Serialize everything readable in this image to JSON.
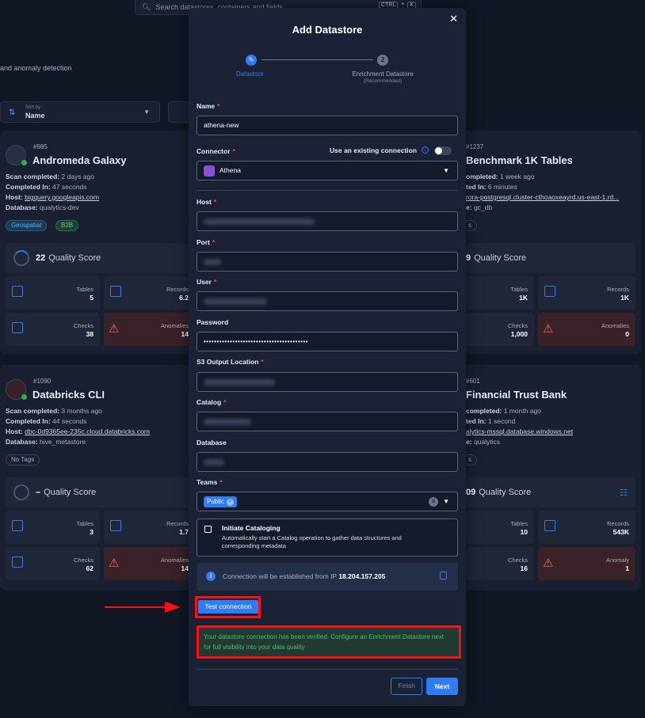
{
  "background": {
    "search_placeholder": "Search datastores, containers and fields",
    "kbd": [
      "CTRL",
      "+",
      "K"
    ],
    "subtitle_fragment": "and anomaly detection",
    "sort": {
      "label": "Sort by",
      "value": "Name"
    },
    "cards": [
      {
        "id": "#985",
        "name": "Andromeda Galaxy",
        "scan_label": "Scan completed:",
        "scan": "2 days ago",
        "completed_label": "Completed In:",
        "completed": "47 seconds",
        "host_label": "Host:",
        "host": "bigquery.googleapis.com",
        "db_label": "Database:",
        "db": "qualytics-dev",
        "tags": [
          "Geospatial",
          "B2B"
        ],
        "quality_score": "22",
        "quality_label": "Quality Score",
        "stats": [
          {
            "label": "Tables",
            "value": "5"
          },
          {
            "label": "Records",
            "value": "6.2"
          },
          {
            "label": "Checks",
            "value": "38"
          },
          {
            "label": "Anomalies",
            "value": "14"
          }
        ]
      },
      {
        "id": "#1237",
        "name": "Benchmark 1K Tables",
        "scan_label": "ompleted:",
        "scan": "1 week ago",
        "completed_label": "ted In:",
        "completed": "6 minutes",
        "host": "rora-postgresql.cluster-cthoaoxeayrd.us-east-1.rd...",
        "db_label": "e:",
        "db": "gc_db",
        "tags_fragment": "s",
        "quality_score": "9",
        "quality_label": "Quality Score",
        "stats": [
          {
            "label": "Tables",
            "value": "1K"
          },
          {
            "label": "Records",
            "value": "1K"
          },
          {
            "label": "Checks",
            "value": "1,000"
          },
          {
            "label": "Anomalies",
            "value": "0"
          }
        ]
      },
      {
        "id": "#1090",
        "name": "Databricks CLI",
        "scan_label": "Scan completed:",
        "scan": "3 months ago",
        "completed_label": "Completed In:",
        "completed": "44 seconds",
        "host_label": "Host:",
        "host": "dbc-0d9365ee-235c.cloud.databricks.com",
        "db_label": "Database:",
        "db": "hive_metastore",
        "tags": [
          "No Tags"
        ],
        "quality_score": "–",
        "quality_label": "Quality Score",
        "stats": [
          {
            "label": "Tables",
            "value": "3"
          },
          {
            "label": "Records",
            "value": "1.7"
          },
          {
            "label": "Checks",
            "value": "62"
          },
          {
            "label": "Anomalies",
            "value": "14"
          }
        ]
      },
      {
        "id": "#601",
        "name": "Financial Trust Bank",
        "scan_label": "completed:",
        "scan": "1 month ago",
        "completed_label": "ted In:",
        "completed": "1 second",
        "host": "alytics-mssql.database.windows.net",
        "db_label": "e:",
        "db": "qualytics",
        "tags_fragment": "s",
        "quality_score": "09",
        "quality_label": "Quality Score",
        "stats": [
          {
            "label": "Tables",
            "value": "10"
          },
          {
            "label": "Records",
            "value": "543K"
          },
          {
            "label": "Checks",
            "value": "16"
          },
          {
            "label": "Anomaly",
            "value": "1"
          }
        ]
      }
    ]
  },
  "modal": {
    "title": "Add Datastore",
    "close": "✕",
    "steps": [
      {
        "label": "Datastore"
      },
      {
        "number": "2",
        "label": "Enrichment Datastore",
        "sublabel": "(Recommended)"
      }
    ],
    "fields": {
      "name": {
        "label": "Name",
        "value": "athena-new"
      },
      "connector": {
        "label": "Connector",
        "value": "Athena",
        "existing_label": "Use an existing connection"
      },
      "host": {
        "label": "Host"
      },
      "port": {
        "label": "Port"
      },
      "user": {
        "label": "User"
      },
      "password": {
        "label": "Password",
        "value": "••••••••••••••••••••••••••••••••••••••••"
      },
      "s3": {
        "label": "S3 Output Location"
      },
      "catalog": {
        "label": "Catalog"
      },
      "database": {
        "label": "Database"
      },
      "teams": {
        "label": "Teams",
        "value": "Public"
      }
    },
    "initiate": {
      "title": "Initiate Cataloging",
      "desc": "Automatically start a Catalog operation to gather data structures and corresponding metadata"
    },
    "ip_info": {
      "text": "Connection will be established from IP",
      "ip": "18.204.157.205"
    },
    "test_button": "Test connection",
    "success_msg": "Your datastore connection has been verified. Configure an Enrichment Datastore next for full visibility into your data quality",
    "finish": "Finish",
    "next": "Next"
  },
  "colors": {
    "accent": "#2f7cf6",
    "highlight": "#ff1010",
    "success": "#3fc46a"
  }
}
